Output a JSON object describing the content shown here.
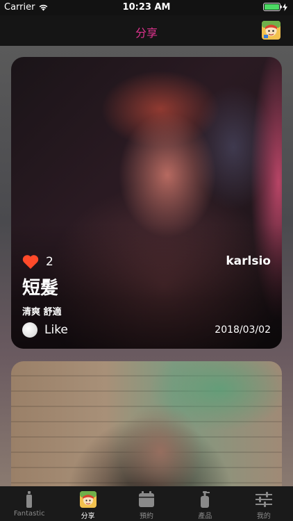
{
  "status_bar": {
    "carrier": "Carrier",
    "time": "10:23 AM",
    "battery_level": 1.0
  },
  "nav": {
    "title": "分享",
    "avatar_icon": "mascot-avatar-icon"
  },
  "posts": [
    {
      "likes": "2",
      "author": "karlsio",
      "title": "短髮",
      "tags": "清爽 舒適",
      "like_label": "Like",
      "date": "2018/03/02"
    }
  ],
  "tabs": [
    {
      "label": "Fantastic",
      "icon": "bottle-icon",
      "active": false
    },
    {
      "label": "分享",
      "icon": "mascot-icon",
      "active": true
    },
    {
      "label": "預約",
      "icon": "calendar-icon",
      "active": false
    },
    {
      "label": "產品",
      "icon": "product-bottle-icon",
      "active": false
    },
    {
      "label": "我的",
      "icon": "sliders-icon",
      "active": false
    }
  ],
  "colors": {
    "accent": "#e0338f",
    "heart": "#ff4a2a",
    "battery": "#4cd964"
  }
}
